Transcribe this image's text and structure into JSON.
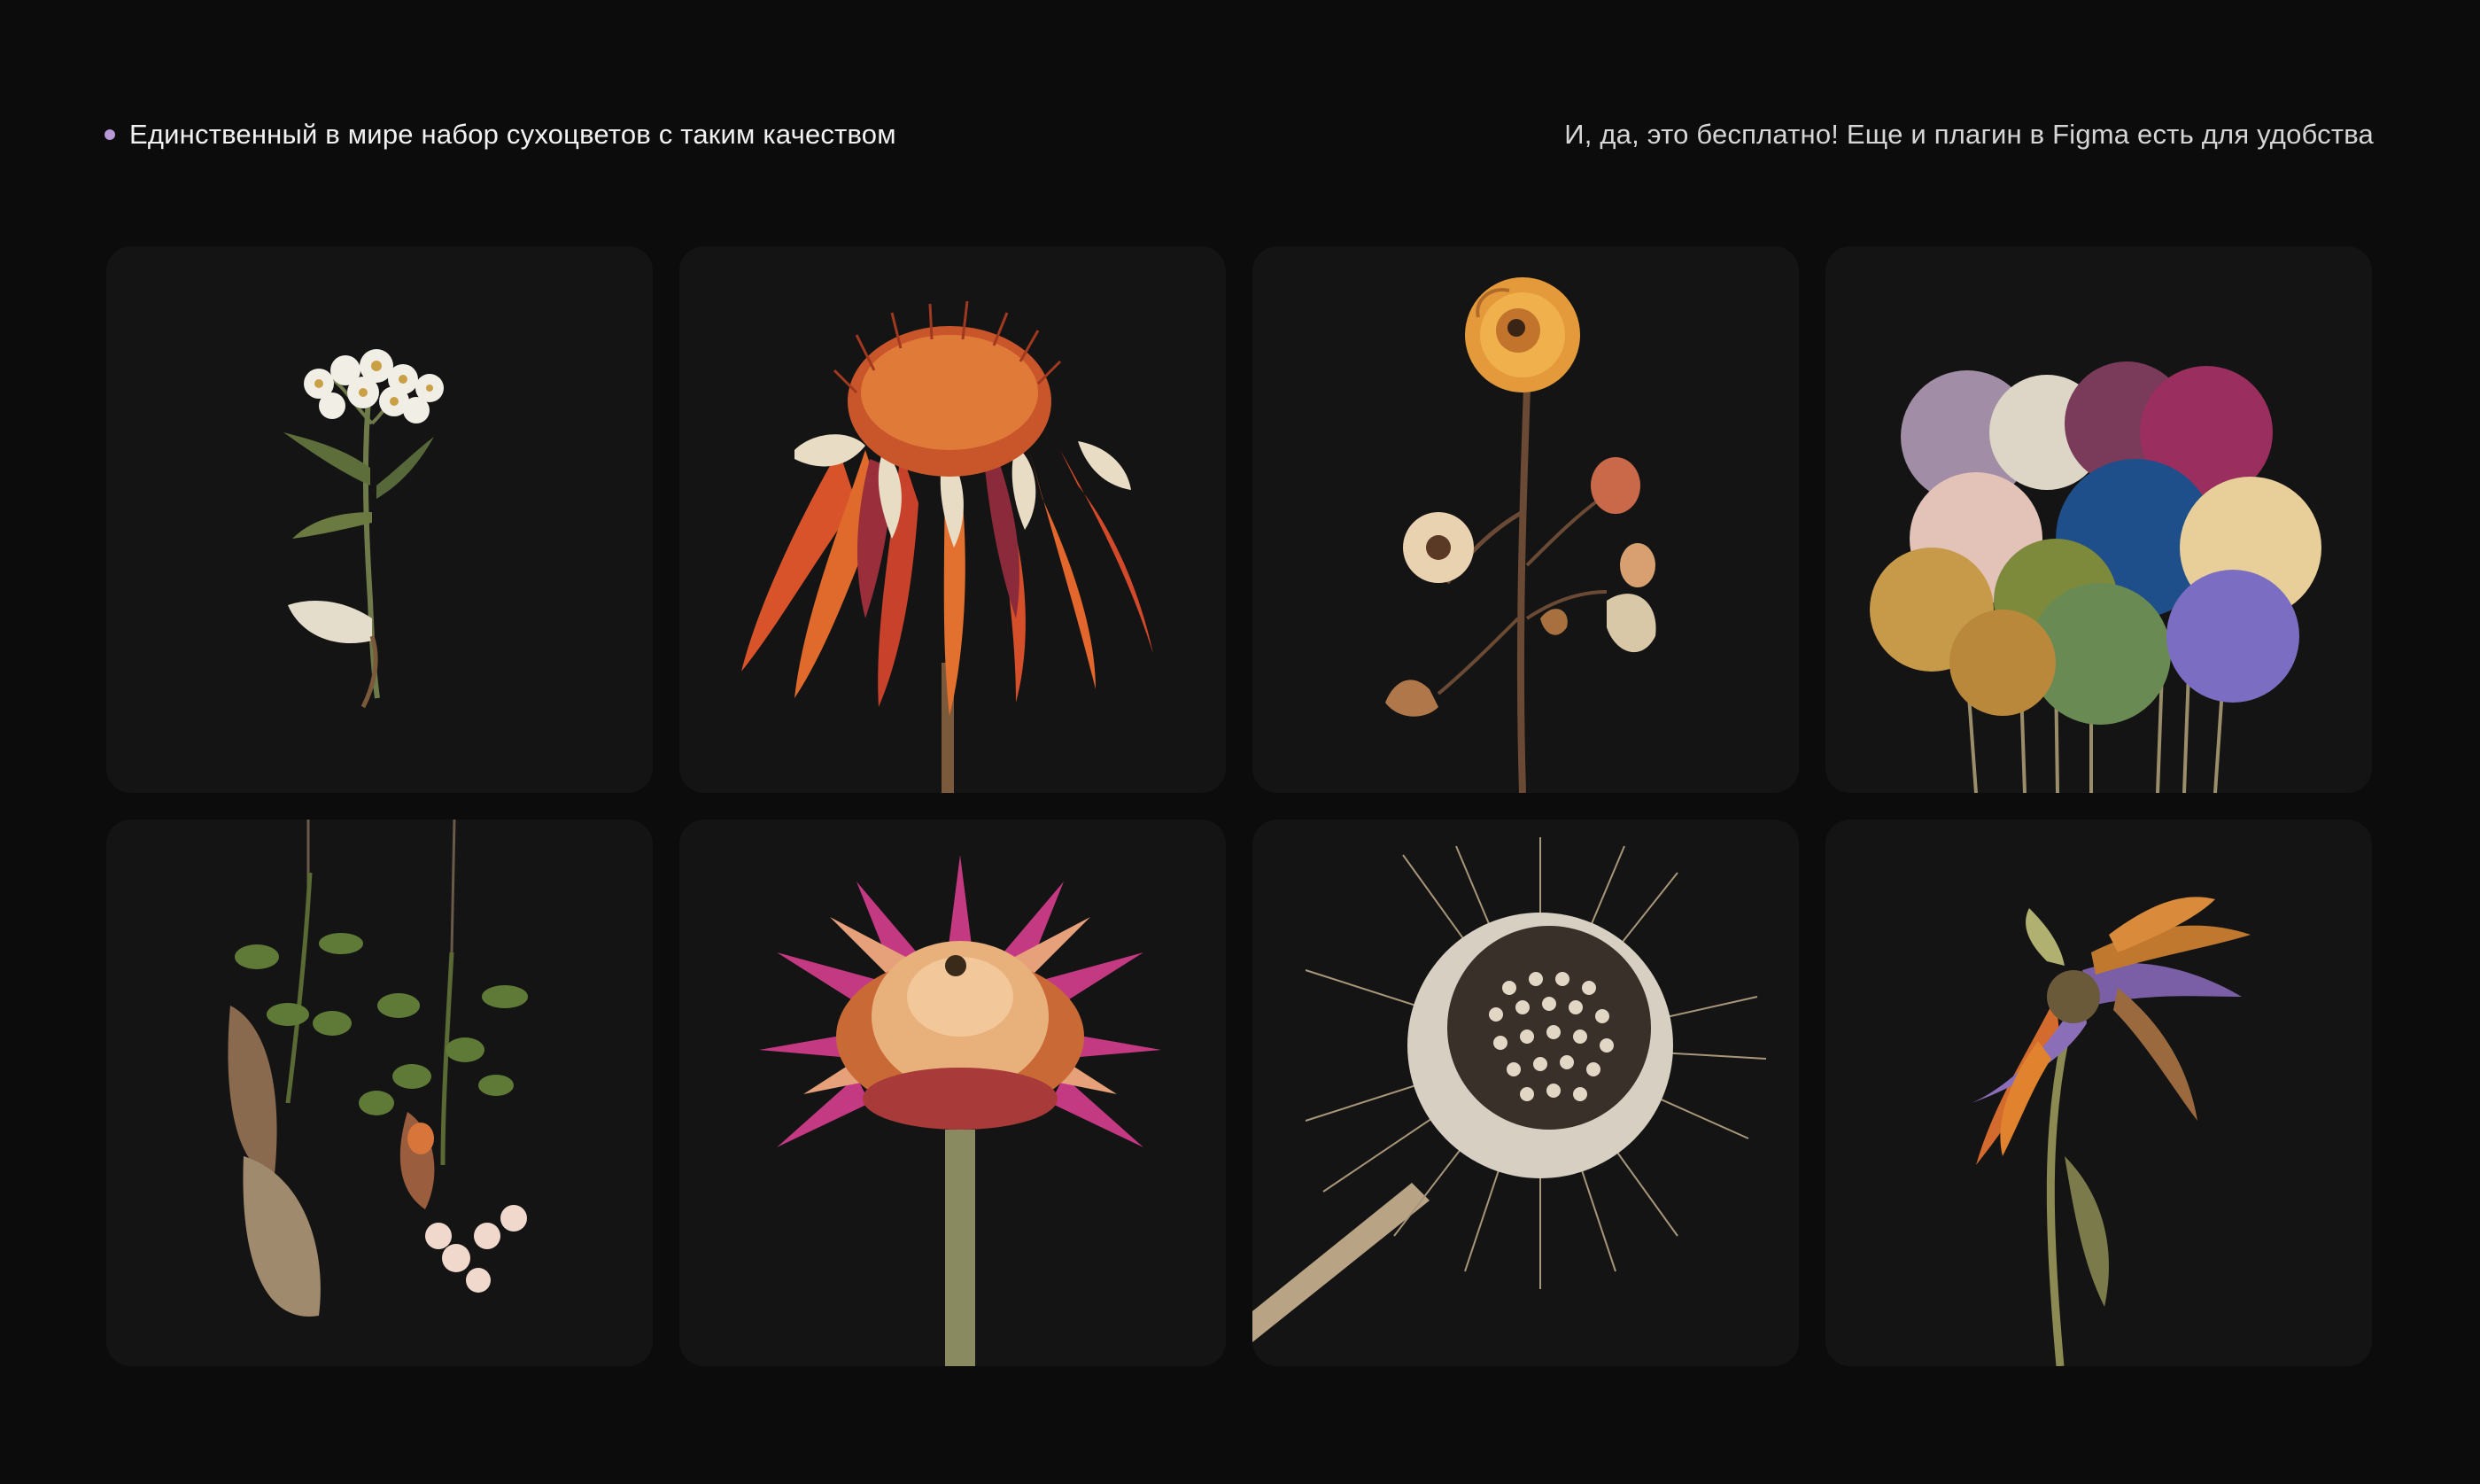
{
  "header": {
    "tagline": "Единственный в мире набор сухоцветов с таким качеством",
    "note": "И, да, это бесплатно! Еще и плагин в Figma есть для удобства",
    "dot_color": "#b79ad6"
  },
  "cards": [
    {
      "icon": "dried-white-wildflower-icon"
    },
    {
      "icon": "dried-echinacea-icon"
    },
    {
      "icon": "dried-rose-branch-icon"
    },
    {
      "icon": "colorful-dried-bouquet-icon"
    },
    {
      "icon": "hanging-dried-flowers-icon"
    },
    {
      "icon": "strawflower-icon"
    },
    {
      "icon": "dried-thistle-seedhead-icon"
    },
    {
      "icon": "wilted-iris-icon"
    }
  ],
  "colors": {
    "background": "#0c0c0c",
    "card": "#151414"
  }
}
